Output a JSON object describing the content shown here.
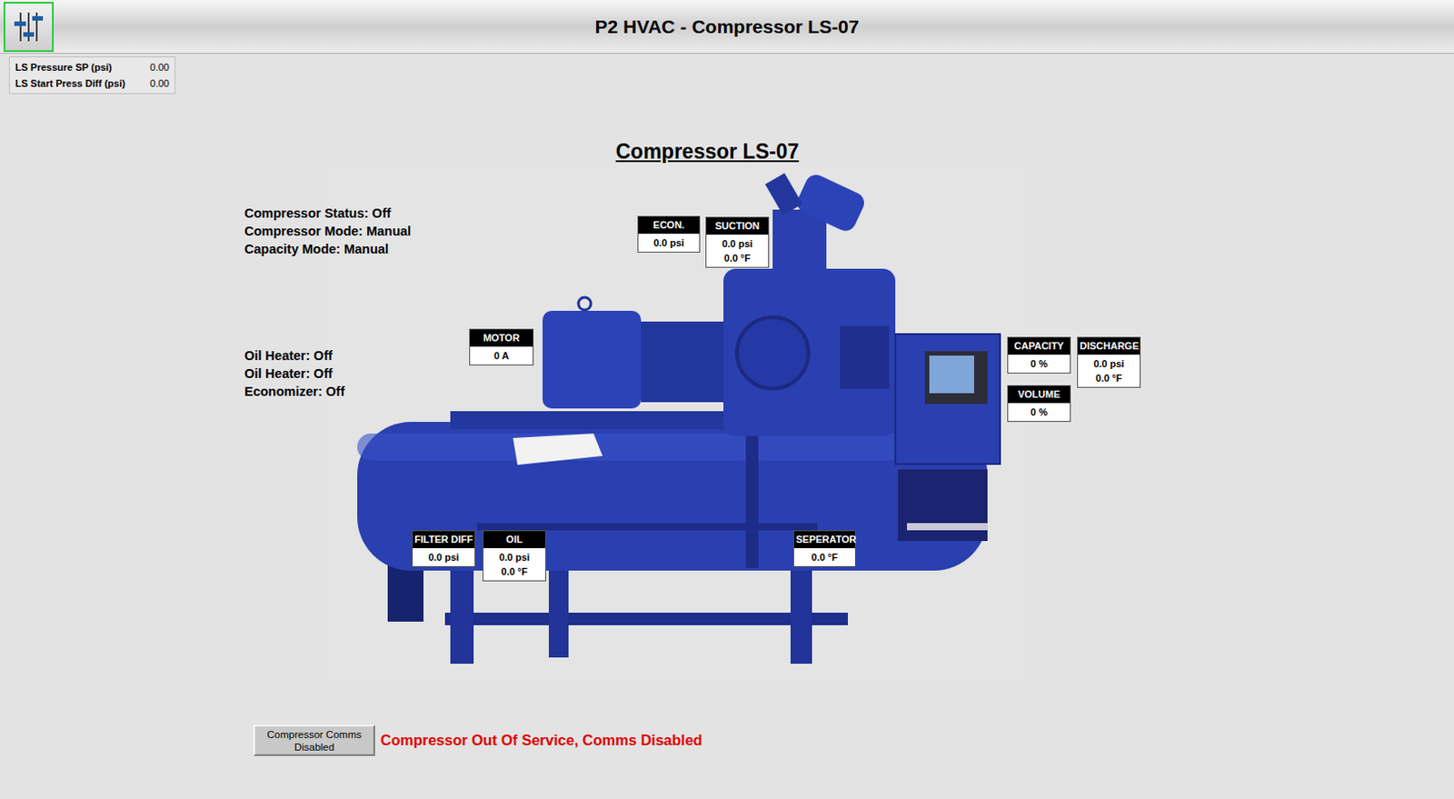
{
  "window": {
    "title": "P2 HVAC - Compressor LS-07"
  },
  "setpoints": [
    {
      "label": "LS Pressure SP (psi)",
      "value": "0.00"
    },
    {
      "label": "LS Start Press Diff (psi)",
      "value": "0.00"
    }
  ],
  "compressor_title": "Compressor LS-07",
  "status_lines": [
    "Compressor Status: Off",
    "Compressor Mode: Manual",
    "Capacity Mode: Manual"
  ],
  "heater_lines": [
    "Oil Heater: Off",
    "Oil Heater: Off",
    "Economizer: Off"
  ],
  "gauges": [
    {
      "label": "ECON.",
      "values": [
        "0.0 psi"
      ]
    },
    {
      "label": "SUCTION",
      "values": [
        "0.0 psi",
        "0.0 °F"
      ]
    },
    {
      "label": "MOTOR",
      "values": [
        "0 A"
      ]
    },
    {
      "label": "CAPACITY",
      "values": [
        "0 %"
      ]
    },
    {
      "label": "DISCHARGE",
      "values": [
        "0.0 psi",
        "0.0 °F"
      ]
    },
    {
      "label": "VOLUME",
      "values": [
        "0 %"
      ]
    },
    {
      "label": "FILTER DIFF",
      "values": [
        "0.0 psi"
      ]
    },
    {
      "label": "OIL",
      "values": [
        "0.0 psi",
        "0.0 °F"
      ]
    },
    {
      "label": "SEPERATOR",
      "values": [
        "0.0 °F"
      ]
    }
  ],
  "comms_button": {
    "label": "Compressor Comms Disabled",
    "disabled": true
  },
  "comms_message": "Compressor Out Of Service, Comms Disabled"
}
